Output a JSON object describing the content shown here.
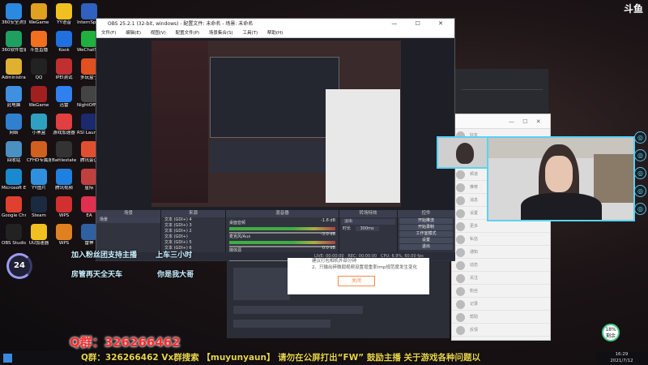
{
  "desktop": {
    "icons": [
      {
        "label": "360安全浏览器",
        "color": "#2a8ae0"
      },
      {
        "label": "WeGame",
        "color": "#e0a020"
      },
      {
        "label": "YY语音",
        "color": "#f0c020"
      },
      {
        "label": "InternSpec",
        "color": "#3060c0"
      },
      {
        "label": "360软件管家",
        "color": "#20a060"
      },
      {
        "label": "斗鱼直播",
        "color": "#f07020"
      },
      {
        "label": "Kook",
        "color": "#2070e0"
      },
      {
        "label": "WeChatSetup",
        "color": "#20b040"
      },
      {
        "label": "Administrator",
        "color": "#e0b030"
      },
      {
        "label": "QQ",
        "color": "#222"
      },
      {
        "label": "IPEI测试",
        "color": "#c03030"
      },
      {
        "label": "多玩盒子",
        "color": "#e05020"
      },
      {
        "label": "此电脑",
        "color": "#4090e0"
      },
      {
        "label": "WeGame",
        "color": "#a02020"
      },
      {
        "label": "迅雷",
        "color": "#3080f0"
      },
      {
        "label": "NightOfFullDead",
        "color": "#444"
      },
      {
        "label": "网络",
        "color": "#3080d0"
      },
      {
        "label": "小黑盒",
        "color": "#30a0c0"
      },
      {
        "label": "游戏加速器",
        "color": "#e04040"
      },
      {
        "label": "RSI Launcher",
        "color": "#1a2a6a"
      },
      {
        "label": "回收站",
        "color": "#4a90c0"
      },
      {
        "label": "CFHD专属服",
        "color": "#d06020"
      },
      {
        "label": "Battlestate Games",
        "color": "#333"
      },
      {
        "label": "腾讯会议",
        "color": "#e05030"
      },
      {
        "label": "Microsoft Edge",
        "color": "#1a8ad0"
      },
      {
        "label": "YY图片",
        "color": "#3090e0"
      },
      {
        "label": "腾讯视频",
        "color": "#2080e0"
      },
      {
        "label": "星际",
        "color": "#c04040"
      },
      {
        "label": "Google Chrome",
        "color": "#e04030"
      },
      {
        "label": "Steam",
        "color": "#1a2a40"
      },
      {
        "label": "WPS",
        "color": "#d03030"
      },
      {
        "label": "EA",
        "color": "#e03050"
      },
      {
        "label": "OBS Studio",
        "color": "#222"
      },
      {
        "label": "UU加速器",
        "color": "#f0c020"
      },
      {
        "label": "WPS",
        "color": "#e08020"
      },
      {
        "label": "雷神",
        "color": "#3060a0"
      }
    ]
  },
  "obs": {
    "title": "OBS 25.2.1 (32-bit, windows) - 配置文件: 未命名 - 场景: 未命名",
    "window_controls": [
      "—",
      "☐",
      "✕"
    ],
    "menu": [
      "文件(F)",
      "编辑(E)",
      "视图(V)",
      "配置文件(P)",
      "场景集合(S)",
      "工具(T)",
      "帮助(H)"
    ],
    "docks": {
      "scenes": {
        "title": "场景",
        "items": [
          "场景"
        ]
      },
      "sources": {
        "title": "来源",
        "items": [
          "文本 (GDI+) 4",
          "文本 (GDI+) 3",
          "文本 (GDI+) 2",
          "文本 (GDI+)",
          "文本 (GDI+) 5",
          "文本 (GDI+) 6"
        ]
      },
      "mixer": {
        "title": "混音器",
        "channels": [
          {
            "name": "桌面音频",
            "db": "-1.8 dB"
          },
          {
            "name": "麦克风/Aux",
            "db": "-3.0 dB"
          },
          {
            "name": "媒体源",
            "db": "0.0 dB"
          }
        ]
      },
      "transitions": {
        "title": "转场特效",
        "type": "淡出",
        "duration_label": "时长",
        "duration": "300ms"
      },
      "controls": {
        "title": "控件",
        "buttons": [
          "开始推流",
          "开始录制",
          "工作室模式",
          "设置",
          "退出"
        ]
      }
    },
    "status": {
      "live": "LIVE: 00:00:00",
      "rec": "REC: 00:00:00",
      "cpu": "CPU: 6.9%, 60.00 fps"
    }
  },
  "dialog": {
    "lines": [
      "建议打包相机外部分钟",
      "2、只输出碎微弱视频设置增重率tmp规范度发生变化"
    ],
    "button": "关闭"
  },
  "chatwin": {
    "toolbar_icons": [
      "—",
      "☐",
      "✕"
    ],
    "items": [
      "好友",
      "群聊",
      "直播间",
      "频道",
      "推荐",
      "消息",
      "设置",
      "更多",
      "私信",
      "通知",
      "动态",
      "关注",
      "粉丝",
      "记录",
      "帮助",
      "反馈"
    ]
  },
  "overlay": {
    "line1_left": "加入粉丝团支持主播",
    "line1_right": "上车三小时",
    "line2_left": "房管再天全天车",
    "line2_right": "你是我大哥",
    "qq_big": "Q群：326266462",
    "ticker": "Q群：326266462 Vx群搜索 【muyunyaun】 请勿在公屏打出“FW” 鼓励主播 关于游戏各种问题以",
    "gauge": "24",
    "fps": "18%\n剩余"
  },
  "brand": {
    "logo": "斗鱼"
  },
  "taskbar": {
    "time": "16:29",
    "date": "2021/7/12"
  },
  "colors": {
    "accent": "#5ad2f4",
    "ticker": "#e8d44a",
    "qq": "#ff2a2a",
    "obs_bg": "#2b2e38"
  }
}
